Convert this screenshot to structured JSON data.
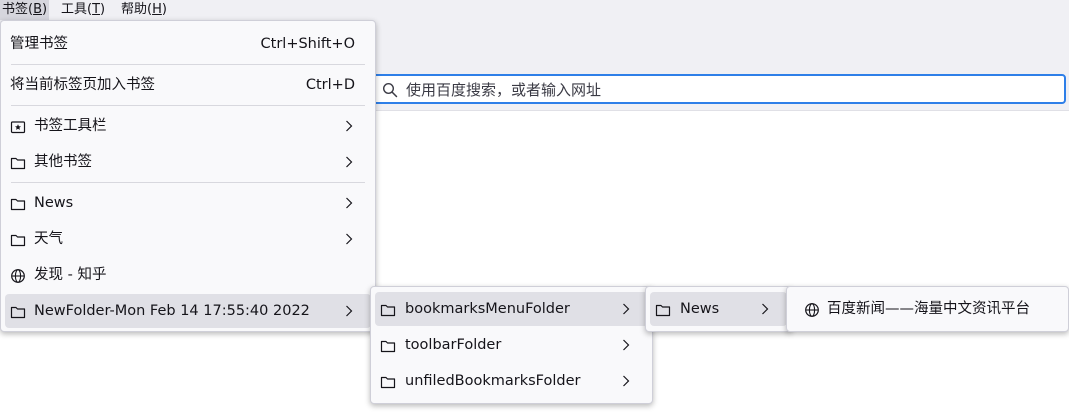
{
  "menubar": [
    {
      "label": "书签(",
      "key": "B",
      "suffix": ")"
    },
    {
      "label": "工具(",
      "key": "T",
      "suffix": ")"
    },
    {
      "label": "帮助(",
      "key": "H",
      "suffix": ")"
    }
  ],
  "urlbar": {
    "placeholder": "使用百度搜索，或者输入网址"
  },
  "bookmarks_menu": {
    "manage": {
      "label": "管理书签",
      "shortcut": "Ctrl+Shift+O"
    },
    "add_current": {
      "label": "将当前标签页加入书签",
      "shortcut": "Ctrl+D"
    },
    "toolbar": {
      "label": "书签工具栏"
    },
    "other": {
      "label": "其他书签"
    },
    "news": {
      "label": "News"
    },
    "weather": {
      "label": "天气"
    },
    "zhihu": {
      "label": "发现 - 知乎"
    },
    "newfolder": {
      "label": "NewFolder-Mon Feb 14 17:55:40 2022"
    }
  },
  "submenu_1": {
    "bookmarks_menu_folder": {
      "label": "bookmarksMenuFolder"
    },
    "toolbar_folder": {
      "label": "toolbarFolder"
    },
    "unfiled_folder": {
      "label": "unfiledBookmarksFolder"
    }
  },
  "submenu_2": {
    "news": {
      "label": "News"
    }
  },
  "submenu_3": {
    "baidu_news": {
      "label": "百度新闻——海量中文资讯平台"
    }
  }
}
